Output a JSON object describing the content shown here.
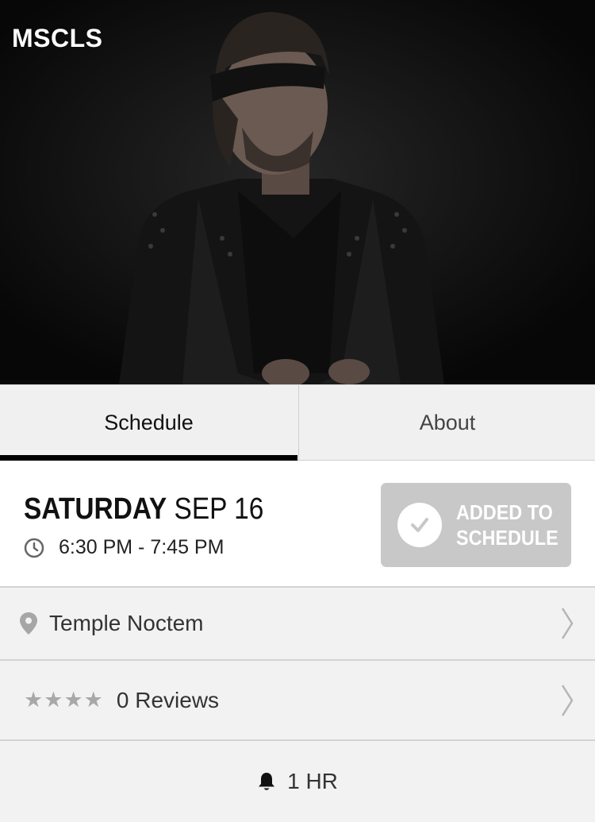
{
  "app": {
    "title": "MSCLS"
  },
  "tabs": [
    {
      "label": "Schedule",
      "active": true
    },
    {
      "label": "About",
      "active": false
    }
  ],
  "event": {
    "day": "SATURDAY",
    "date": "SEP 16",
    "time": "6:30 PM - 7:45 PM",
    "schedule_button": "ADDED TO\nSCHEDULE"
  },
  "venue": {
    "name": "Temple Noctem"
  },
  "reviews": {
    "label": "0 Reviews",
    "stars_shown": 4
  },
  "reminder": {
    "label": "1 HR"
  },
  "icons": {
    "clock": "clock-icon",
    "check": "check-icon",
    "pin": "location-pin-icon",
    "star": "star-icon",
    "chevron": "chevron-right-icon",
    "bell": "bell-icon"
  },
  "colors": {
    "tab_indicator": "#000000",
    "added_button_bg": "#c8c8c8",
    "hero_bg": "#0b0b0b"
  }
}
